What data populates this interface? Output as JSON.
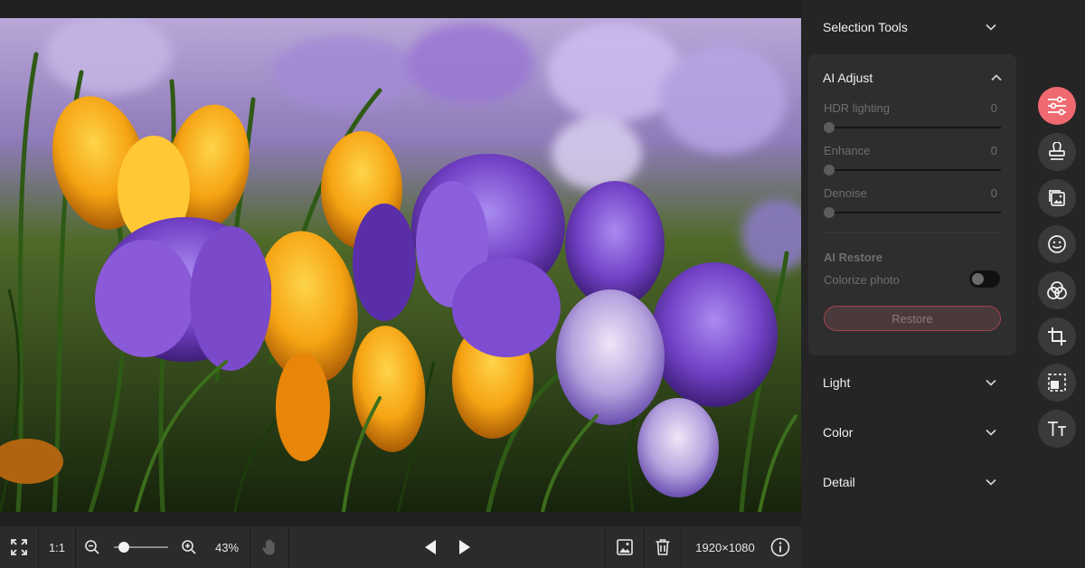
{
  "toolbar": {
    "fit_icon": "fullscreen-expand-icon",
    "actual_size_label": "1:1",
    "zoom_value": "43%",
    "zoom_fraction": 0.1,
    "resolution": "1920×1080"
  },
  "panel": {
    "sections": {
      "selection_tools": "Selection Tools",
      "ai_adjust": "AI Adjust",
      "light": "Light",
      "color": "Color",
      "detail": "Detail"
    },
    "ai_adjust": {
      "sliders": [
        {
          "label": "HDR lighting",
          "value": "0"
        },
        {
          "label": "Enhance",
          "value": "0"
        },
        {
          "label": "Denoise",
          "value": "0"
        }
      ],
      "restore_title": "AI Restore",
      "colorize_label": "Colorize photo",
      "colorize_on": false,
      "restore_button": "Restore"
    }
  },
  "tools": [
    {
      "icon": "adjust-sliders-icon",
      "active": true
    },
    {
      "icon": "stamp-icon",
      "active": false
    },
    {
      "icon": "image-icon",
      "active": false
    },
    {
      "icon": "smiley-face-icon",
      "active": false
    },
    {
      "icon": "color-circles-icon",
      "active": false
    },
    {
      "icon": "crop-icon",
      "active": false
    },
    {
      "icon": "object-select-icon",
      "active": false
    },
    {
      "icon": "text-tool-icon",
      "active": false
    }
  ],
  "colors": {
    "accent": "#ef6a70",
    "panel_bg": "#252525",
    "card_bg": "#2e2e2e",
    "toolbar_bg": "#2b2b2b"
  }
}
